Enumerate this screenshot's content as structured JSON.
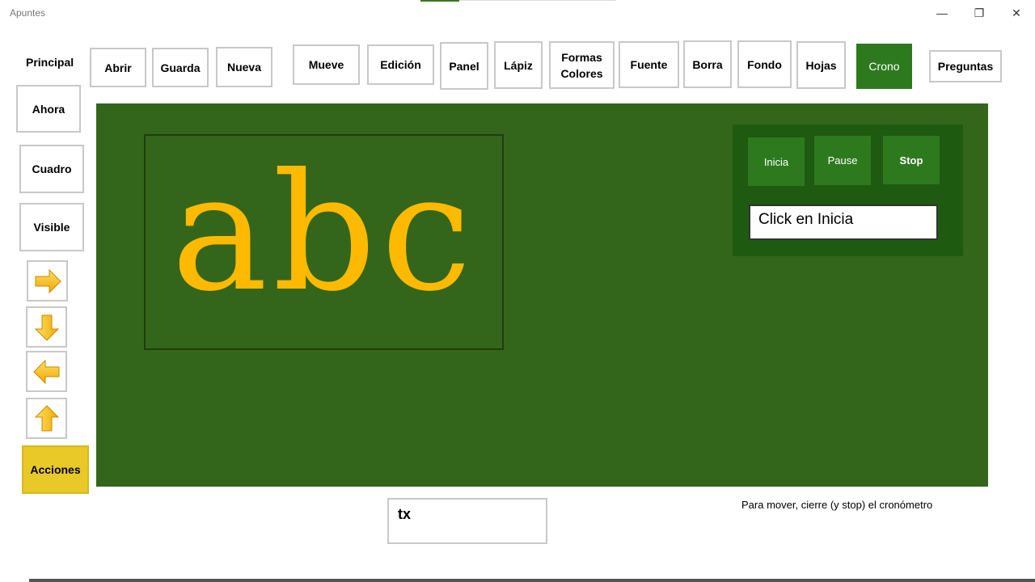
{
  "window": {
    "title": "Apuntes",
    "controls": {
      "minimize": "—",
      "restore": "❐",
      "close": "✕"
    }
  },
  "sidebar": {
    "heading": "Principal",
    "buttons": {
      "ahora": "Ahora",
      "cuadro": "Cuadro",
      "visible": "Visible",
      "acciones": "Acciones"
    },
    "arrows": [
      "arrow-right-icon",
      "arrow-down-icon",
      "arrow-left-icon",
      "arrow-up-icon"
    ]
  },
  "toolbar": {
    "abrir": "Abrir",
    "guarda": "Guarda",
    "nueva": "Nueva",
    "mueve": "Mueve",
    "edicion": "Edición",
    "panel": "Panel",
    "lapiz": "Lápiz",
    "formas_line1": "Formas",
    "formas_line2": "Colores",
    "fuente": "Fuente",
    "borra": "Borra",
    "fondo": "Fondo",
    "hojas": "Hojas",
    "crono": "Crono",
    "preguntas": "Preguntas"
  },
  "board": {
    "text": "abc",
    "colors": {
      "board": "#33661a",
      "text": "#ffba00"
    }
  },
  "crono": {
    "inicia": "Inicia",
    "pause": "Pause",
    "stop": "Stop",
    "display": "Click en Inicia"
  },
  "footer": {
    "tx_value": "tx",
    "hint": "Para mover, cierre (y stop) el cronómetro"
  }
}
